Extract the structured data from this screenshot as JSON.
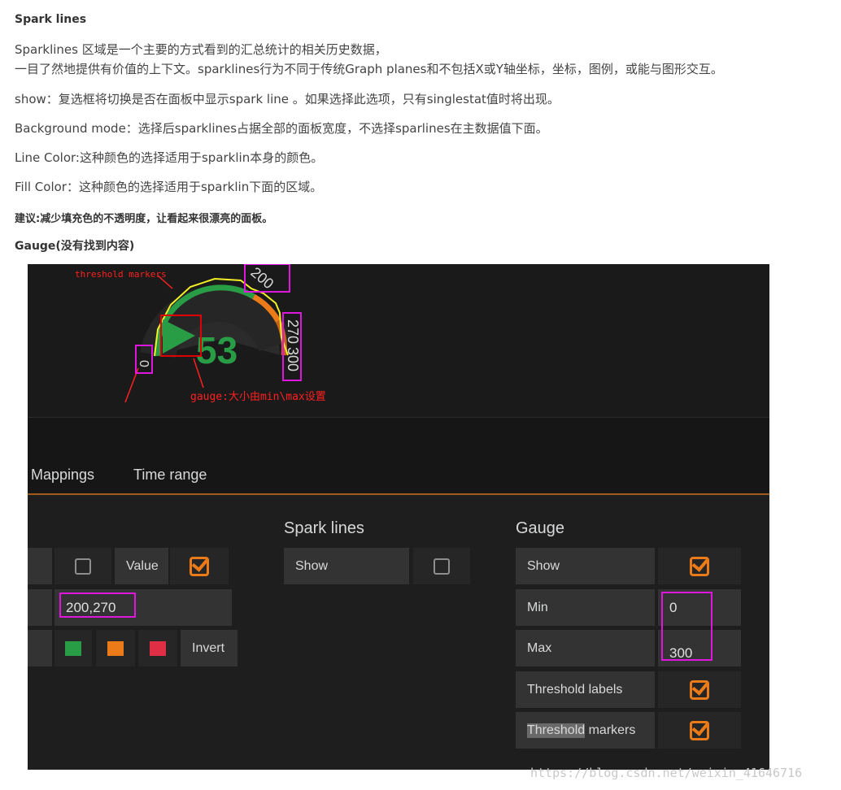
{
  "article": {
    "heading_spark": "Spark lines",
    "p1_line1": "Sparklines 区域是一个主要的方式看到的汇总统计的相关历史数据，",
    "p1_line2": "一目了然地提供有价值的上下文。sparklines行为不同于传统Graph planes和不包括X或Y轴坐标，坐标，图例，或能与图形交互。",
    "p_show": "show：复选框将切换是否在面板中显示spark line 。如果选择此选项，只有singlestat值时将出现。",
    "p_bg": "Background mode：选择后sparklines占据全部的面板宽度，不选择sparlines在主数据值下面。",
    "p_line_color": "Line Color:这种颜色的选择适用于sparklin本身的颜色。",
    "p_fill_color": "Fill Color：这种颜色的选择适用于sparklin下面的区域。",
    "p_suggest": "建议:减少填充色的不透明度，让看起来很漂亮的面板。",
    "heading_gauge": "Gauge(没有找到内容)"
  },
  "gauge": {
    "value": "53",
    "min_label": "0",
    "t1_label": "200",
    "t2_label": "270",
    "max_label": "300",
    "annot_threshold": "threshold markers",
    "annot_gauge": "gauge:大小由min\\max设置",
    "colors": {
      "green": "#299c46",
      "orange": "#eb7b18",
      "red": "#e02f44",
      "marker": "#f2f026"
    }
  },
  "tabs": {
    "mappings": "Mappings",
    "time_range": "Time range"
  },
  "editor": {
    "value_label": "Value",
    "thresholds_value": "200,270",
    "invert_label": "Invert",
    "spark": {
      "title": "Spark lines",
      "show": "Show"
    },
    "gauge": {
      "title": "Gauge",
      "show": "Show",
      "min": "Min",
      "min_value": "0",
      "max": "Max",
      "max_value": "300",
      "threshold_labels": "Threshold labels",
      "threshold_markers_a": "Threshold",
      "threshold_markers_b": " markers"
    }
  },
  "watermark": "https://blog.csdn.net/weixin_41646716"
}
